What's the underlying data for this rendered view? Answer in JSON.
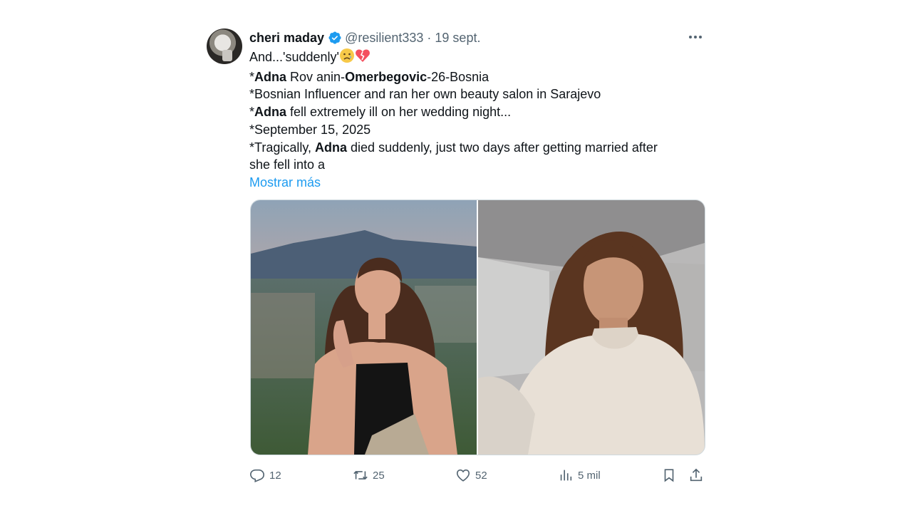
{
  "author": {
    "name": "cheri maday",
    "handle": "@resilient333",
    "separator": "·",
    "date": "19 sept.",
    "verified": true
  },
  "post": {
    "lines": [
      {
        "parts": [
          {
            "t": "And...'suddenly'",
            "b": false
          }
        ],
        "emojis": [
          "sad-face",
          "broken-heart"
        ]
      },
      {
        "parts": [
          {
            "t": "*",
            "b": false
          },
          {
            "t": "Adna",
            "b": true
          },
          {
            "t": " Rov anin-",
            "b": false
          },
          {
            "t": "Omerbegovic",
            "b": true
          },
          {
            "t": "-26-Bosnia",
            "b": false
          }
        ]
      },
      {
        "parts": [
          {
            "t": "*Bosnian Influencer and ran her own beauty salon in Sarajevo",
            "b": false
          }
        ]
      },
      {
        "parts": [
          {
            "t": "*",
            "b": false
          },
          {
            "t": "Adna",
            "b": true
          },
          {
            "t": " fell extremely ill on her wedding night...",
            "b": false
          }
        ]
      },
      {
        "parts": [
          {
            "t": "*September 15, 2025",
            "b": false
          }
        ]
      },
      {
        "parts": [
          {
            "t": "*Tragically, ",
            "b": false
          },
          {
            "t": "Adna",
            "b": true
          },
          {
            "t": " died suddenly, just two days after getting married after",
            "b": false
          }
        ]
      },
      {
        "parts": [
          {
            "t": "she fell into a",
            "b": false
          }
        ]
      }
    ],
    "show_more": "Mostrar más"
  },
  "media": {
    "images": [
      {
        "name": "photo-woman-smiling-outdoors"
      },
      {
        "name": "photo-woman-selfie-sweater"
      }
    ]
  },
  "actions": {
    "replies": "12",
    "reposts": "25",
    "likes": "52",
    "views": "5 mil"
  },
  "colors": {
    "accent": "#1d9bf0",
    "secondary_text": "#536471",
    "primary_text": "#0f1419",
    "broken_heart": "#f4505f",
    "sad_face": "#f7c948"
  },
  "icons": [
    "verified-badge-icon",
    "more-icon",
    "reply-icon",
    "repost-icon",
    "like-icon",
    "views-icon",
    "bookmark-icon",
    "share-icon"
  ]
}
